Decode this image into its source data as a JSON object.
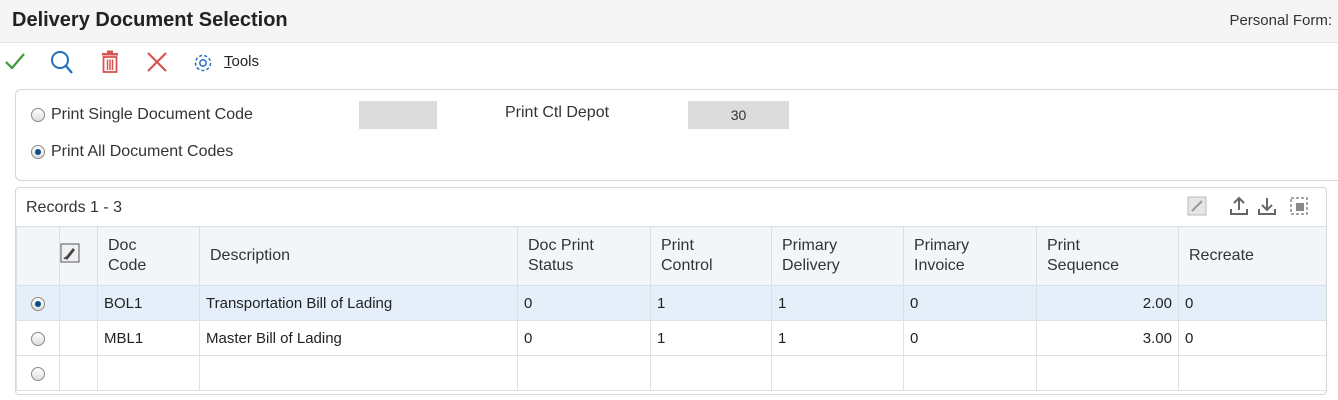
{
  "window": {
    "title": "Delivery Document Selection",
    "personal_form_label": "Personal Form:"
  },
  "toolbar": {
    "ok_icon": "checkmark-icon",
    "find_icon": "search-icon",
    "delete_icon": "trash-icon",
    "cancel_icon": "close-icon",
    "tools_icon": "gear-icon",
    "tools_label_first": "T",
    "tools_label_rest": "ools"
  },
  "header": {
    "single_label": "Print Single Document Code",
    "single_value": "",
    "all_label": "Print All Document Codes",
    "depot_label": "Print Ctl Depot",
    "depot_value": "30"
  },
  "grid": {
    "records_label": "Records 1 - 3",
    "columns": {
      "doc_code": [
        "Doc",
        "Code"
      ],
      "description": "Description",
      "doc_print_status": [
        "Doc Print",
        "Status"
      ],
      "print_control": [
        "Print",
        "Control"
      ],
      "primary_delivery": [
        "Primary",
        "Delivery"
      ],
      "primary_invoice": [
        "Primary",
        "Invoice"
      ],
      "print_sequence": [
        "Print",
        "Sequence"
      ],
      "recreate": "Recreate"
    },
    "rows": [
      {
        "doc_code": "BOL1",
        "description": "Transportation Bill of Lading",
        "doc_print_status": "0",
        "print_control": "1",
        "primary_delivery": "1",
        "primary_invoice": "0",
        "print_sequence": "2.00",
        "recreate": "0"
      },
      {
        "doc_code": "MBL1",
        "description": "Master Bill of Lading",
        "doc_print_status": "0",
        "print_control": "1",
        "primary_delivery": "1",
        "primary_invoice": "0",
        "print_sequence": "3.00",
        "recreate": "0"
      }
    ]
  },
  "colors": {
    "accent_blue": "#1f6fbf",
    "ok_green": "#3c9a3c",
    "delete_red": "#d9534f",
    "selected_row": "#e4eff9"
  }
}
